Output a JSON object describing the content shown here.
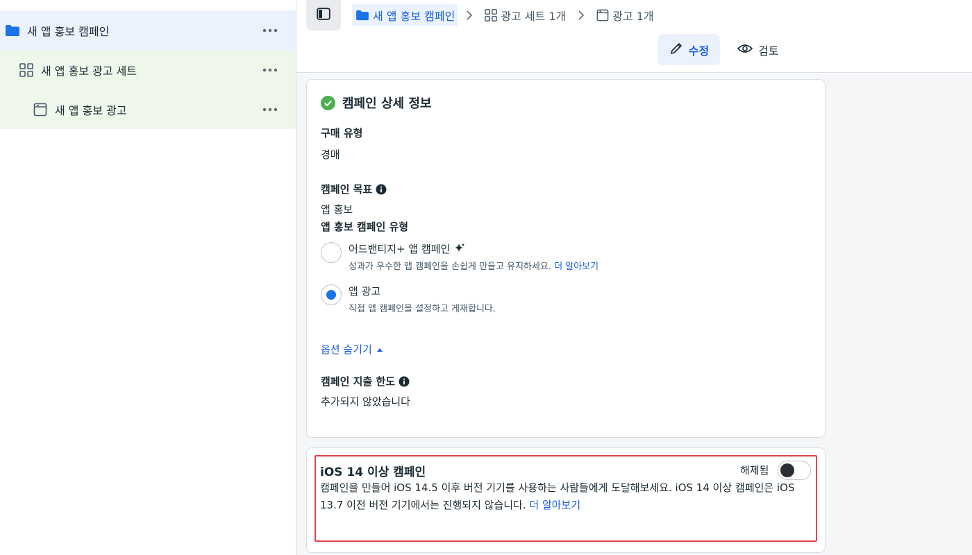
{
  "sidebar": {
    "items": [
      {
        "label": "새 앱 홍보 캠페인",
        "icon": "folder-icon"
      },
      {
        "label": "새 앱 홍보 광고 세트",
        "icon": "grid-icon"
      },
      {
        "label": "새 앱 홍보 광고",
        "icon": "ad-window-icon"
      }
    ]
  },
  "topbar": {
    "breadcrumbs": [
      {
        "label": "새 앱 홍보 캠페인",
        "icon": "folder-icon"
      },
      {
        "label": "광고 세트 1개",
        "icon": "grid-icon"
      },
      {
        "label": "광고 1개",
        "icon": "ad-window-icon"
      }
    ],
    "edit_label": "수정",
    "review_label": "검토"
  },
  "details": {
    "title": "캠페인 상세 정보",
    "buying_type": {
      "label": "구매 유형",
      "value": "경매"
    },
    "objective": {
      "label": "캠페인 목표",
      "value": "앱 홍보"
    },
    "app_campaign_type": {
      "label": "앱 홍보 캠페인 유형",
      "options": [
        {
          "title": "어드밴티지+ 앱 캠페인",
          "desc": "성과가 우수한 앱 캠페인을 손쉽게 만들고 유지하세요.",
          "link": "더 알아보기",
          "selected": false
        },
        {
          "title": "앱 광고",
          "desc": "직접 앱 캠페인을 설정하고 게재합니다.",
          "selected": true
        }
      ]
    },
    "hide_options": "옵션 숨기기",
    "spend_limit": {
      "label": "캠페인 지출 한도",
      "value": "추가되지 않았습니다"
    }
  },
  "ios": {
    "title": "iOS 14 이상 캠페인",
    "toggle_label": "해제됨",
    "toggle_on": false,
    "desc": "캠페인을 만들어 iOS 14.5 이후 버전 기기를 사용하는 사람들에게 도달해보세요. iOS 14 이상 캠페인은 iOS 13.7 이전 버전 기기에서는 진행되지 않습니다.",
    "link": "더 알아보기"
  },
  "colors": {
    "accent": "#1a5fd6",
    "highlight_border": "#e0454b",
    "success": "#4caf50"
  }
}
